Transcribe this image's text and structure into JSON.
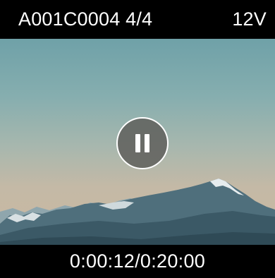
{
  "header": {
    "clip_name": "A001C0004 4/4",
    "voltage": "12V"
  },
  "viewer": {
    "state_icon": "pause-icon"
  },
  "footer": {
    "timecode": "0:00:12/0:20:00"
  },
  "colors": {
    "bar_background": "#000000",
    "text": "#ffffff",
    "button_fill": "#5f5f5c",
    "sky_top": "#6fa1a8",
    "sky_bottom": "#c9b8a0"
  }
}
